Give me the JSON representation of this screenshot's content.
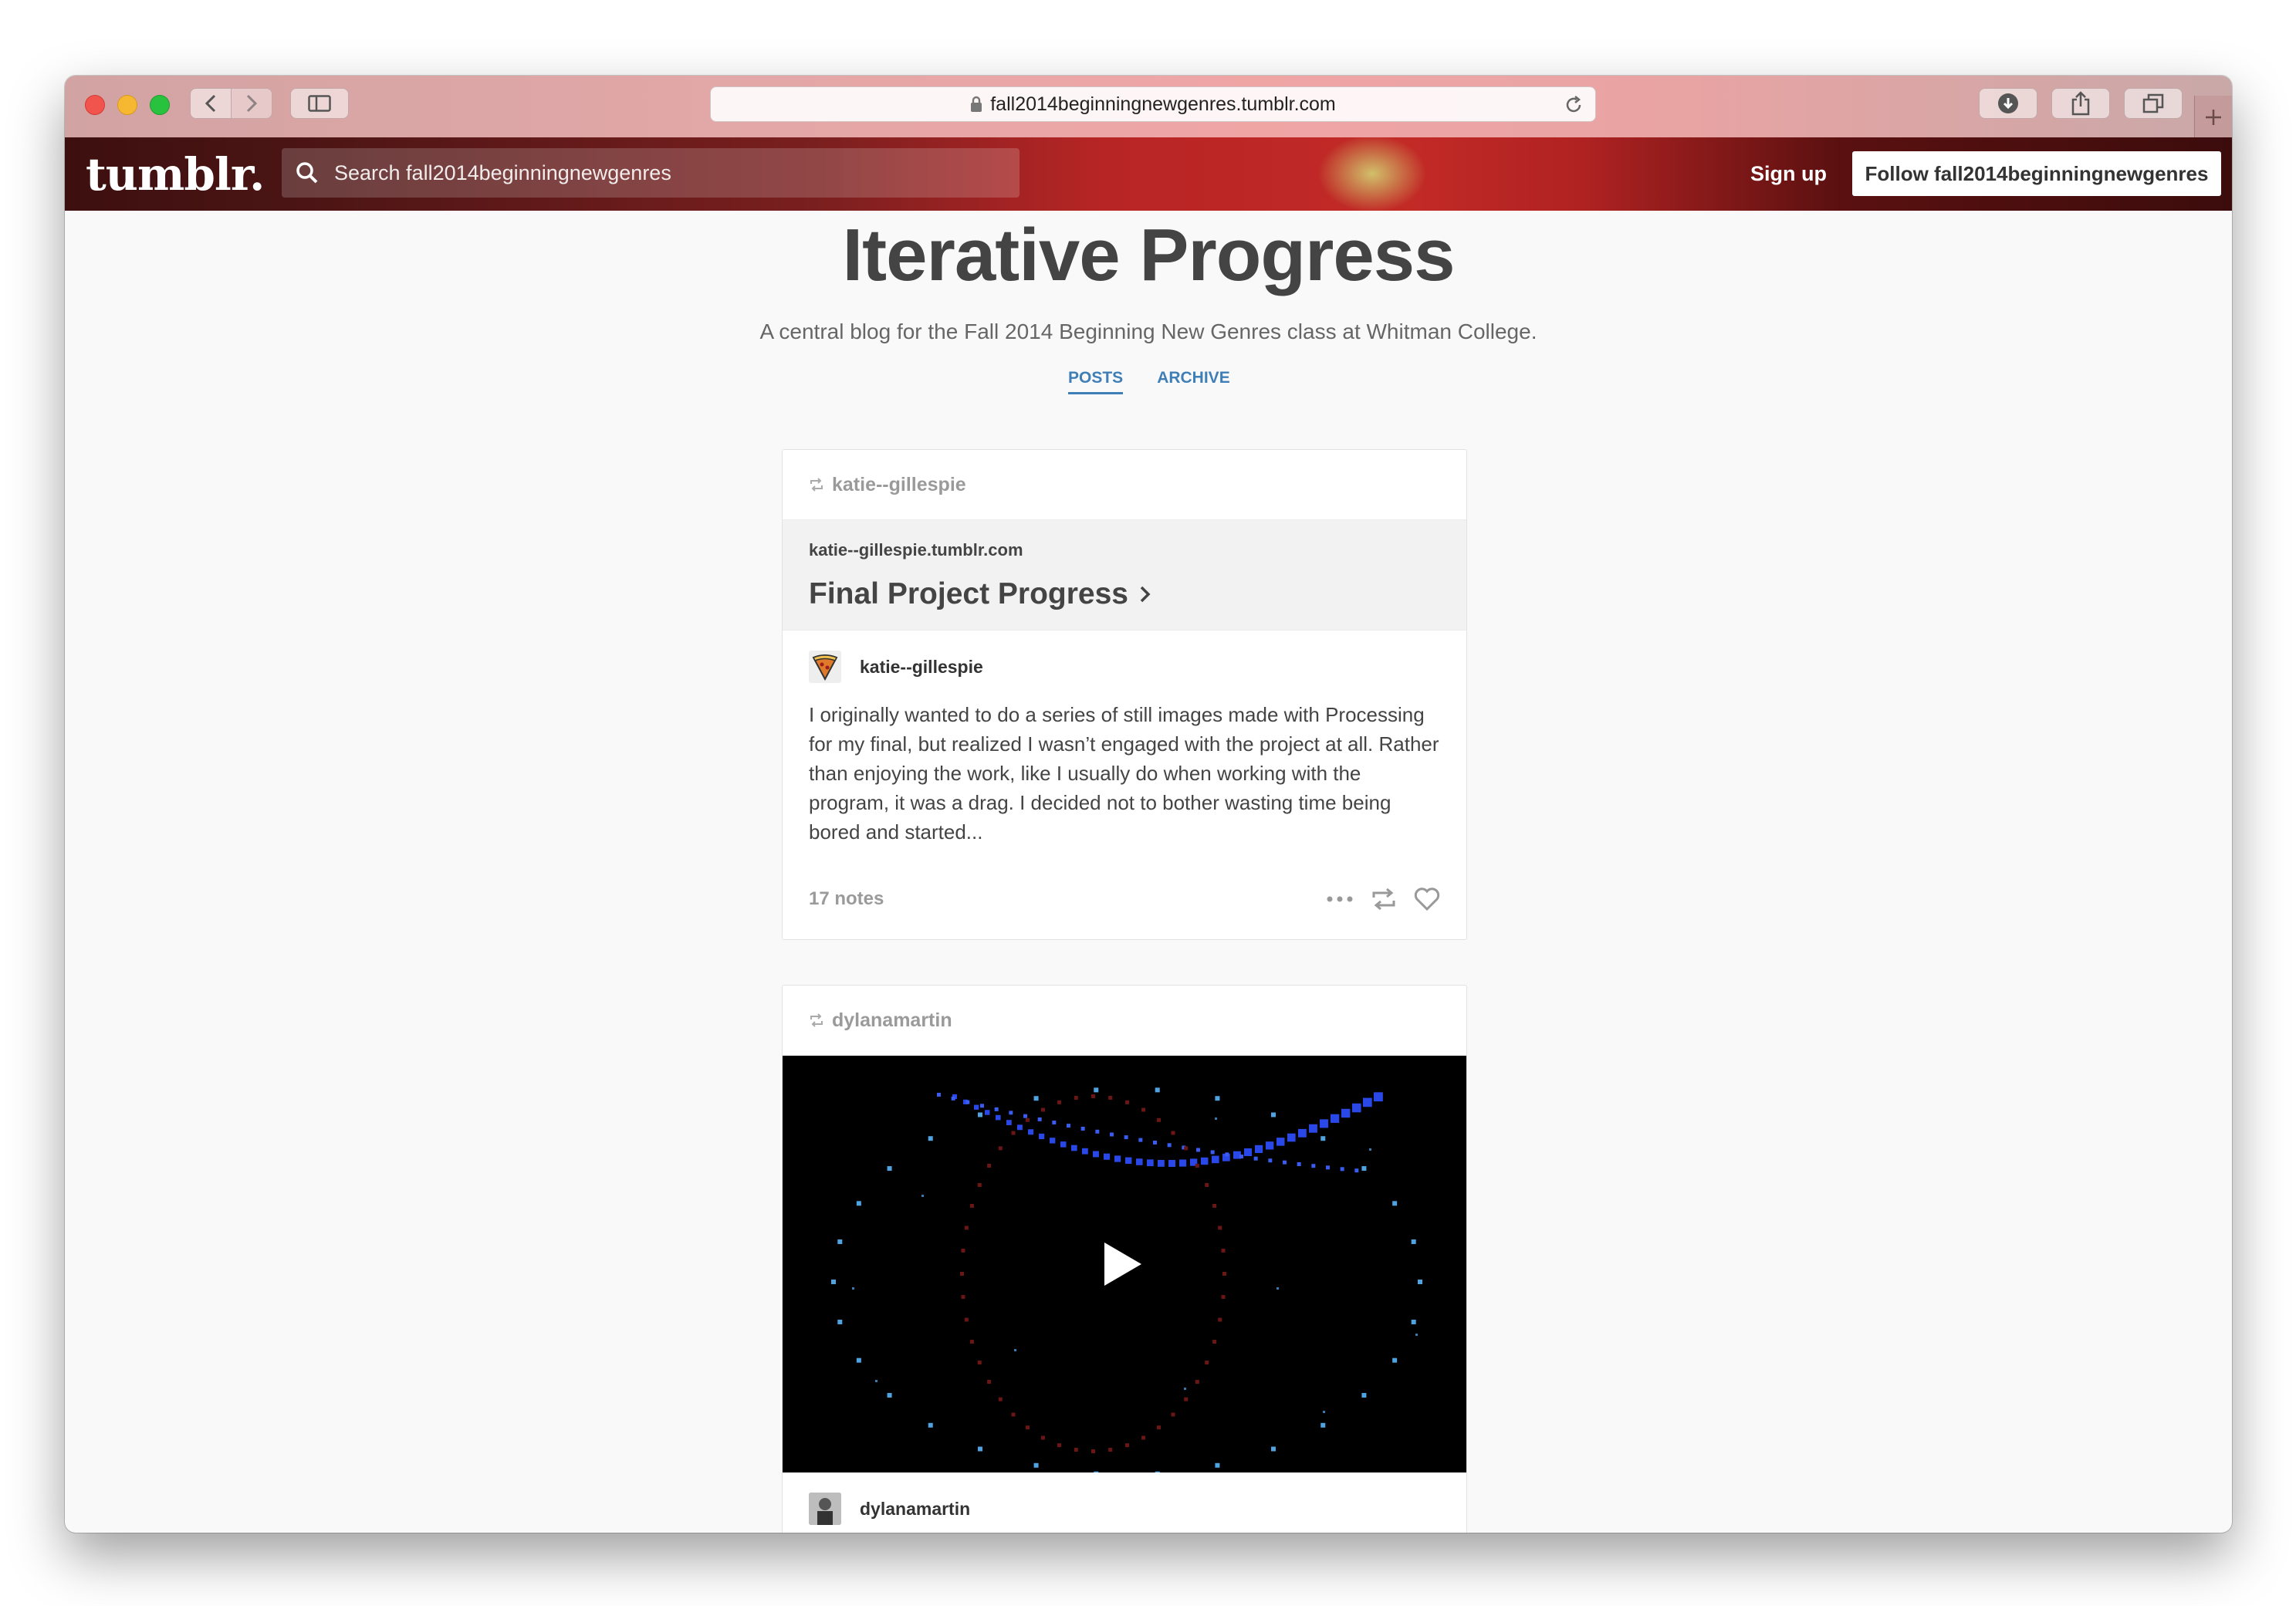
{
  "browser": {
    "url": "fall2014beginningnewgenres.tumblr.com"
  },
  "tumblr_header": {
    "logo": "tumblr.",
    "search_placeholder": "Search fall2014beginningnewgenres",
    "signup_label": "Sign up",
    "follow_label": "Follow fall2014beginningnewgenres"
  },
  "blog": {
    "title": "Iterative Progress",
    "description": "A central blog for the Fall 2014 Beginning New Genres class at Whitman College.",
    "nav": {
      "posts": "POSTS",
      "archive": "ARCHIVE"
    }
  },
  "posts": [
    {
      "reblogged_from": "katie--gillespie",
      "link_host": "katie--gillespie.tumblr.com",
      "link_title": "Final Project Progress",
      "author": "katie--gillespie",
      "body": "I originally wanted to do a series of still images made with Processing for my final, but realized I wasn’t engaged with the project at all. Rather than enjoying the work, like I usually do when working with the program, it was a drag. I decided not to bother wasting time being bored and started...",
      "notes": "17 notes"
    },
    {
      "reblogged_from": "dylanamartin",
      "author": "dylanamartin"
    }
  ],
  "icons": {
    "lock": "lock-icon",
    "reload": "reload-icon",
    "search": "search-icon",
    "reblog": "reblog-icon",
    "more": "more-icon",
    "like": "heart-icon",
    "play": "play-icon"
  }
}
